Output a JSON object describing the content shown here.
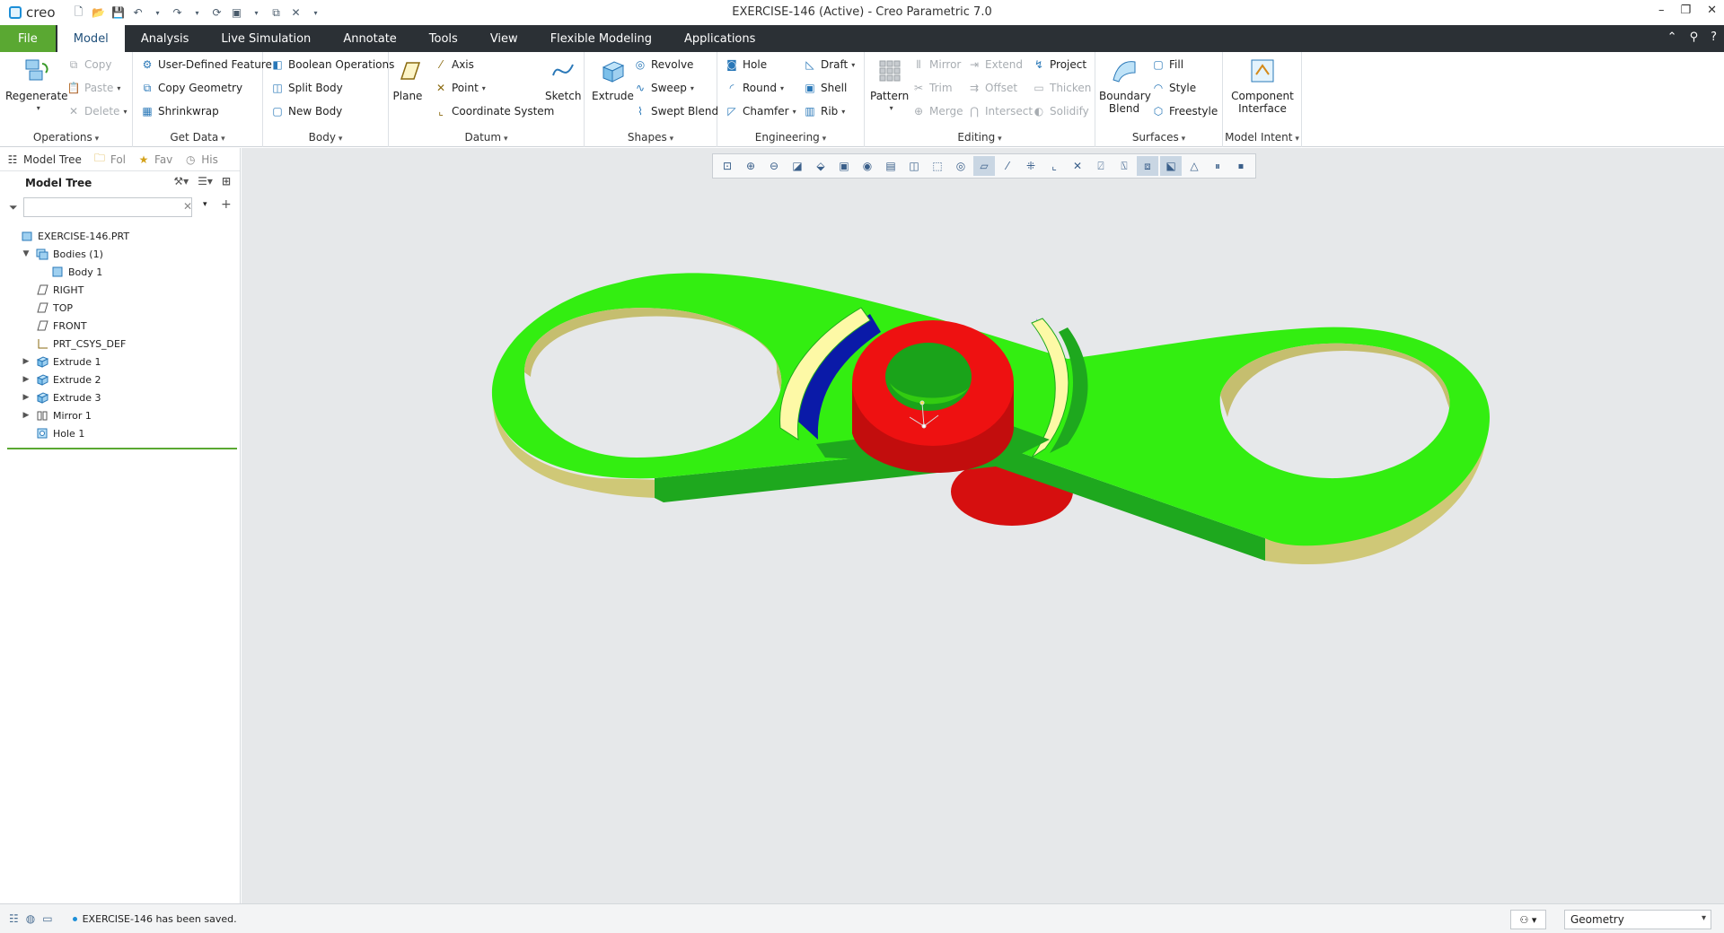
{
  "window": {
    "logo": "creo",
    "title": "EXERCISE-146 (Active) - Creo Parametric 7.0",
    "controls": [
      "–",
      "❐",
      "✕"
    ]
  },
  "tabs": [
    "File",
    "Model",
    "Analysis",
    "Live Simulation",
    "Annotate",
    "Tools",
    "View",
    "Flexible Modeling",
    "Applications"
  ],
  "active_tab": "Model",
  "ribbon": {
    "operations": {
      "title": "Operations",
      "regenerate": "Regenerate",
      "copy": "Copy",
      "paste": "Paste",
      "delete": "Delete"
    },
    "get_data": {
      "title": "Get Data",
      "udf": "User-Defined Feature",
      "copy_geometry": "Copy Geometry",
      "shrinkwrap": "Shrinkwrap"
    },
    "body": {
      "title": "Body",
      "boolean": "Boolean Operations",
      "split": "Split Body",
      "new": "New Body"
    },
    "datum": {
      "title": "Datum",
      "plane": "Plane",
      "axis": "Axis",
      "point": "Point",
      "csys": "Coordinate System",
      "sketch": "Sketch"
    },
    "shapes": {
      "title": "Shapes",
      "extrude": "Extrude",
      "revolve": "Revolve",
      "sweep": "Sweep",
      "swept_blend": "Swept Blend"
    },
    "engineering": {
      "title": "Engineering",
      "hole": "Hole",
      "round": "Round",
      "chamfer": "Chamfer",
      "draft": "Draft",
      "shell": "Shell",
      "rib": "Rib"
    },
    "editing": {
      "title": "Editing",
      "pattern": "Pattern",
      "mirror": "Mirror",
      "trim": "Trim",
      "merge": "Merge",
      "extend": "Extend",
      "offset": "Offset",
      "intersect": "Intersect",
      "project": "Project",
      "thicken": "Thicken",
      "solidify": "Solidify"
    },
    "surfaces": {
      "title": "Surfaces",
      "boundary_blend": "Boundary Blend",
      "fill": "Fill",
      "style": "Style",
      "freestyle": "Freestyle"
    },
    "model_intent": {
      "title": "Model Intent",
      "component_interface": "Component Interface"
    }
  },
  "left_panel": {
    "tabs": [
      "Model Tree",
      "Fol",
      "Fav",
      "His"
    ],
    "header": "Model Tree",
    "search_value": "",
    "tree": [
      {
        "label": "EXERCISE-146.PRT",
        "indent": 0,
        "toggle": "",
        "icon": "part-icon"
      },
      {
        "label": "Bodies (1)",
        "indent": 1,
        "toggle": "▼",
        "icon": "bodies-icon"
      },
      {
        "label": "Body 1",
        "indent": 2,
        "toggle": "",
        "icon": "body-icon"
      },
      {
        "label": "RIGHT",
        "indent": 1,
        "toggle": "",
        "icon": "datum-plane-icon"
      },
      {
        "label": "TOP",
        "indent": 1,
        "toggle": "",
        "icon": "datum-plane-icon"
      },
      {
        "label": "FRONT",
        "indent": 1,
        "toggle": "",
        "icon": "datum-plane-icon"
      },
      {
        "label": "PRT_CSYS_DEF",
        "indent": 1,
        "toggle": "",
        "icon": "csys-icon"
      },
      {
        "label": "Extrude 1",
        "indent": 1,
        "toggle": "▶",
        "icon": "extrude-icon"
      },
      {
        "label": "Extrude 2",
        "indent": 1,
        "toggle": "▶",
        "icon": "extrude-icon"
      },
      {
        "label": "Extrude 3",
        "indent": 1,
        "toggle": "▶",
        "icon": "extrude-icon"
      },
      {
        "label": "Mirror 1",
        "indent": 1,
        "toggle": "▶",
        "icon": "mirror-icon"
      },
      {
        "label": "Hole 1",
        "indent": 1,
        "toggle": "",
        "icon": "hole-icon"
      }
    ]
  },
  "model_colors": {
    "top": "#33ee11",
    "side_green": "#1aa31a",
    "side_yellow": "#d6d27a",
    "boss": "#ee1111",
    "boss_side": "#c20d0d",
    "blue": "#0a1aa8",
    "cream": "#fdf9a6"
  },
  "status": {
    "message": "EXERCISE-146 has been saved.",
    "selection_filter": "Geometry"
  }
}
